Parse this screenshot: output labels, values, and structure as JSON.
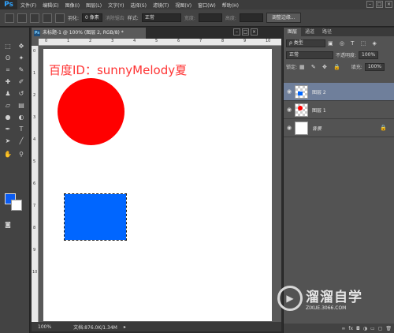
{
  "app": {
    "logo": "Ps"
  },
  "menubar": {
    "items": [
      "文件(F)",
      "编辑(E)",
      "图像(I)",
      "图层(L)",
      "文字(Y)",
      "选择(S)",
      "滤镜(T)",
      "视图(V)",
      "窗口(W)",
      "帮助(H)"
    ]
  },
  "options": {
    "feather_label": "羽化:",
    "feather_value": "0 像素",
    "antialias_label": "消除锯齿",
    "style_label": "样式:",
    "style_value": "正常",
    "width_label": "宽度:",
    "height_label": "高度:",
    "refine_button": "调整边缘..."
  },
  "document": {
    "tab_title": "未标题-1 @ 100% (图层 2, RGB/8) *",
    "zoom": "100%",
    "doc_size": "文档:876.0K/1.34M"
  },
  "canvas": {
    "text": "百度ID：sunnyMelody夏",
    "text_color": "#ff3333",
    "circle_color": "#ff0000",
    "rect_color": "#0066ff"
  },
  "colors": {
    "foreground": "#0b5cf2",
    "background": "#ffffff"
  },
  "panel": {
    "tabs": [
      "图层",
      "通道",
      "路径"
    ],
    "kind_filter": "ρ 类型",
    "blend_mode": "正常",
    "opacity_label": "不透明度:",
    "opacity_value": "100%",
    "lock_label": "锁定:",
    "fill_label": "填充:",
    "fill_value": "100%",
    "layers": [
      {
        "name": "图层 2",
        "selected": true
      },
      {
        "name": "图层 1",
        "selected": false
      },
      {
        "name": "背景",
        "selected": false
      }
    ]
  },
  "watermark": {
    "title": "溜溜自学",
    "url": "ZIXUE.3066.COM"
  },
  "ruler": {
    "top": [
      "0",
      "1",
      "2",
      "3",
      "4",
      "5",
      "6",
      "7",
      "8",
      "9",
      "10"
    ],
    "left": [
      "0",
      "1",
      "2",
      "3",
      "4",
      "5",
      "6",
      "7",
      "8",
      "9",
      "10"
    ]
  }
}
